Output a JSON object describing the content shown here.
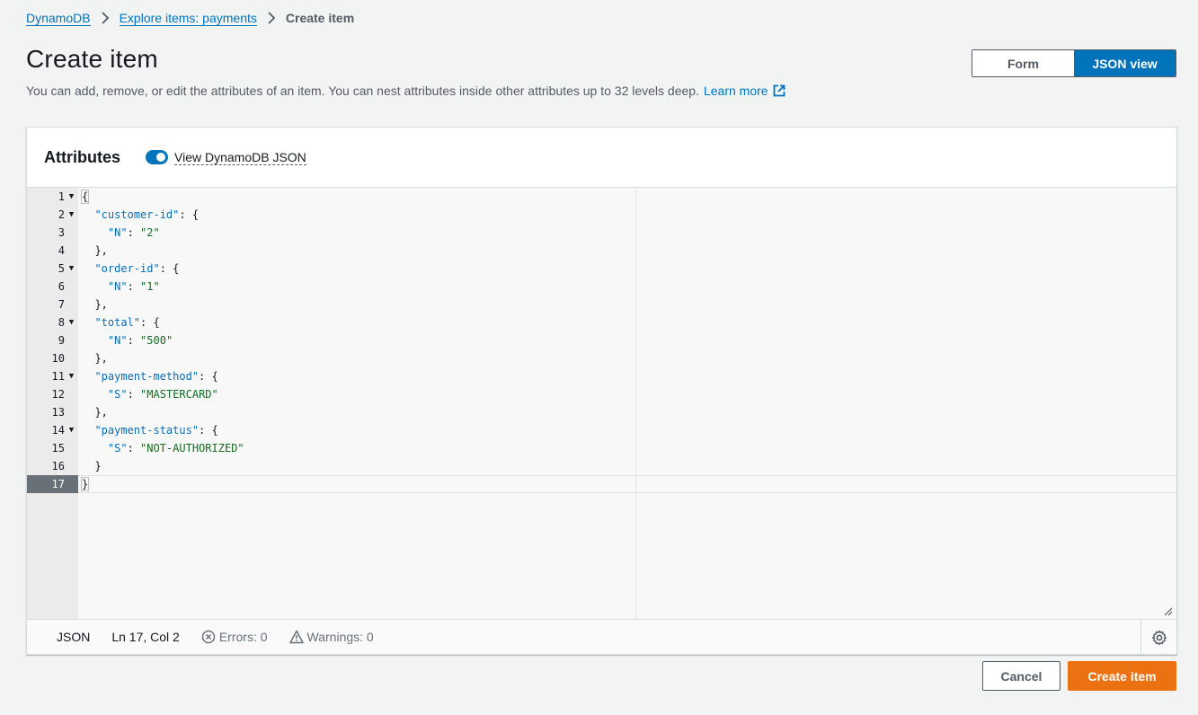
{
  "breadcrumb": {
    "items": [
      {
        "label": "DynamoDB"
      },
      {
        "label": "Explore items: payments"
      }
    ],
    "current": "Create item"
  },
  "page": {
    "title": "Create item",
    "description": "You can add, remove, or edit the attributes of an item. You can nest attributes inside other attributes up to 32 levels deep.",
    "learn_more": "Learn more"
  },
  "view_toggle": {
    "options": [
      "Form",
      "JSON view"
    ],
    "selected": "JSON view"
  },
  "attributes": {
    "title": "Attributes",
    "toggle_label": "View DynamoDB JSON",
    "toggle_on": true
  },
  "editor": {
    "lines": [
      {
        "n": "1",
        "fold": true,
        "text": "{"
      },
      {
        "n": "2",
        "fold": true,
        "key": "\"customer-id\"",
        "rest": ": {"
      },
      {
        "n": "3",
        "fold": false,
        "indent": "    ",
        "key": "\"N\"",
        "val": "\"2\""
      },
      {
        "n": "4",
        "fold": false,
        "indent": "  ",
        "text": "},"
      },
      {
        "n": "5",
        "fold": true,
        "key": "\"order-id\"",
        "rest": ": {"
      },
      {
        "n": "6",
        "fold": false,
        "indent": "    ",
        "key": "\"N\"",
        "val": "\"1\""
      },
      {
        "n": "7",
        "fold": false,
        "indent": "  ",
        "text": "},"
      },
      {
        "n": "8",
        "fold": true,
        "key": "\"total\"",
        "rest": ": {"
      },
      {
        "n": "9",
        "fold": false,
        "indent": "    ",
        "key": "\"N\"",
        "val": "\"500\""
      },
      {
        "n": "10",
        "fold": false,
        "indent": "  ",
        "text": "},"
      },
      {
        "n": "11",
        "fold": true,
        "key": "\"payment-method\"",
        "rest": ": {"
      },
      {
        "n": "12",
        "fold": false,
        "indent": "    ",
        "key": "\"S\"",
        "val": "\"MASTERCARD\""
      },
      {
        "n": "13",
        "fold": false,
        "indent": "  ",
        "text": "},"
      },
      {
        "n": "14",
        "fold": true,
        "key": "\"payment-status\"",
        "rest": ": {"
      },
      {
        "n": "15",
        "fold": false,
        "indent": "    ",
        "key": "\"S\"",
        "val": "\"NOT-AUTHORIZED\""
      },
      {
        "n": "16",
        "fold": false,
        "indent": "  ",
        "text": "}"
      },
      {
        "n": "17",
        "fold": false,
        "text": "}",
        "active": true
      }
    ]
  },
  "status_bar": {
    "language": "JSON",
    "position": "Ln 17, Col 2",
    "errors": "Errors: 0",
    "warnings": "Warnings: 0"
  },
  "footer": {
    "cancel_label": "Cancel",
    "create_label": "Create item"
  },
  "colors": {
    "accent": "#0073bb",
    "primary_button": "#ec7211"
  }
}
